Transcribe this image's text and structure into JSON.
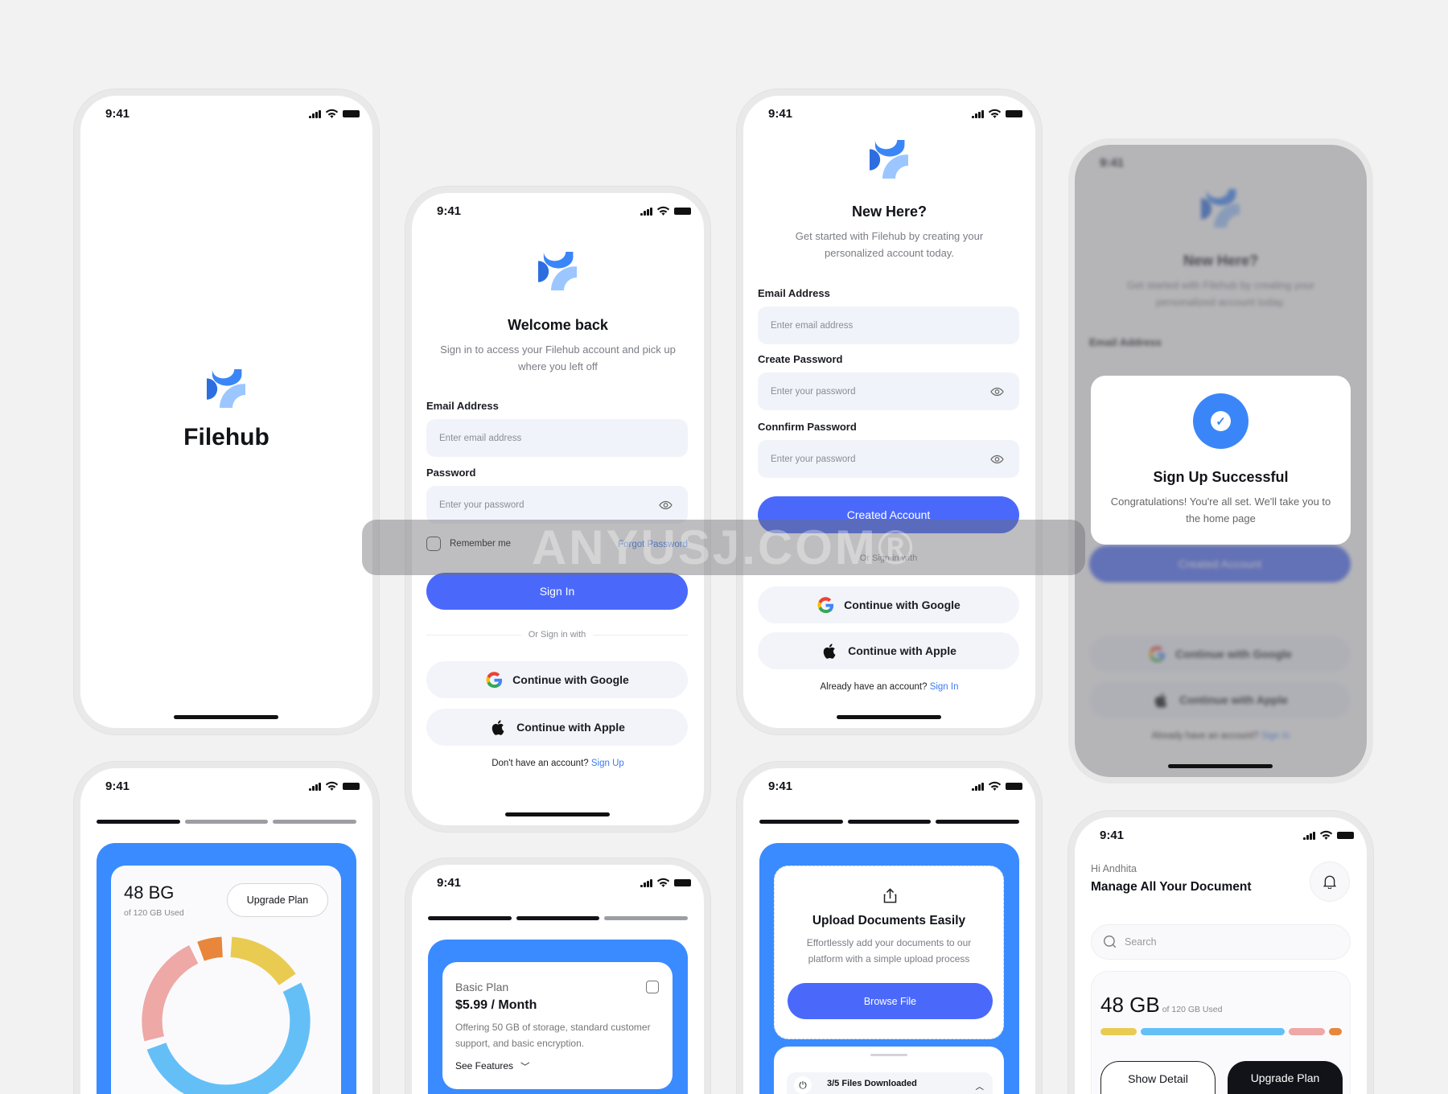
{
  "status": {
    "time": "9:41"
  },
  "colors": {
    "primary": "#4a69fb",
    "card_blue": "#3a8bff",
    "link": "#3b7bf0",
    "yellow": "#e9cb52",
    "sky": "#64bff7",
    "pink": "#eea8a6",
    "orange": "#e8863b"
  },
  "splash": {
    "app_name": "Filehub"
  },
  "signin": {
    "title": "Welcome back",
    "subtitle": "Sign in to access your Filehub account and pick up where you left off",
    "email_label": "Email Address",
    "email_placeholder": "Enter email address",
    "password_label": "Password",
    "password_placeholder": "Enter your password",
    "remember": "Remember me",
    "forgot": "Forgot Password",
    "submit": "Sign In",
    "divider": "Or Sign in with",
    "google": "Continue with Google",
    "apple": "Continue with Apple",
    "footer_text": "Don't have an account?",
    "footer_link": "Sign Up"
  },
  "signup": {
    "title": "New Here?",
    "subtitle": "Get started with Filehub by creating your personalized account today.",
    "email_label": "Email Address",
    "email_placeholder": "Enter email address",
    "create_label": "Create Password",
    "create_placeholder": "Enter your password",
    "confirm_label": "Connfirm Password",
    "confirm_placeholder": "Enter your password",
    "submit": "Created Account",
    "divider": "Or Sign in with",
    "google": "Continue with Google",
    "apple": "Continue with Apple",
    "footer_text": "Already have an account?",
    "footer_link": "Sign In"
  },
  "success_modal": {
    "title": "Sign Up Successful",
    "body": "Congratulations! You're all set. We'll take you to the home page"
  },
  "onboard_storage": {
    "step": 1,
    "steps": 3,
    "used": "48 BG",
    "of": "of 120 GB Used",
    "upgrade": "Upgrade Plan"
  },
  "onboard_plan": {
    "step": 2,
    "steps": 3,
    "plan": "Basic Plan",
    "price": "$5.99 / Month",
    "desc": "Offering 50 GB of storage, standard customer support, and basic encryption.",
    "see": "See Features"
  },
  "onboard_upload": {
    "step": 3,
    "steps": 3,
    "title": "Upload Documents Easily",
    "desc": "Effortlessly add your documents to our platform with a simple upload process",
    "browse": "Browse File",
    "progress": "3/5 Files Downloaded"
  },
  "home": {
    "greeting": "Hi Andhita",
    "title": "Manage All Your Document",
    "search_placeholder": "Search",
    "used": "48 GB",
    "of": "of 120 GB Used",
    "show_detail": "Show Detail",
    "upgrade": "Upgrade Plan"
  },
  "watermark": "ANYUSJ.COM®"
}
